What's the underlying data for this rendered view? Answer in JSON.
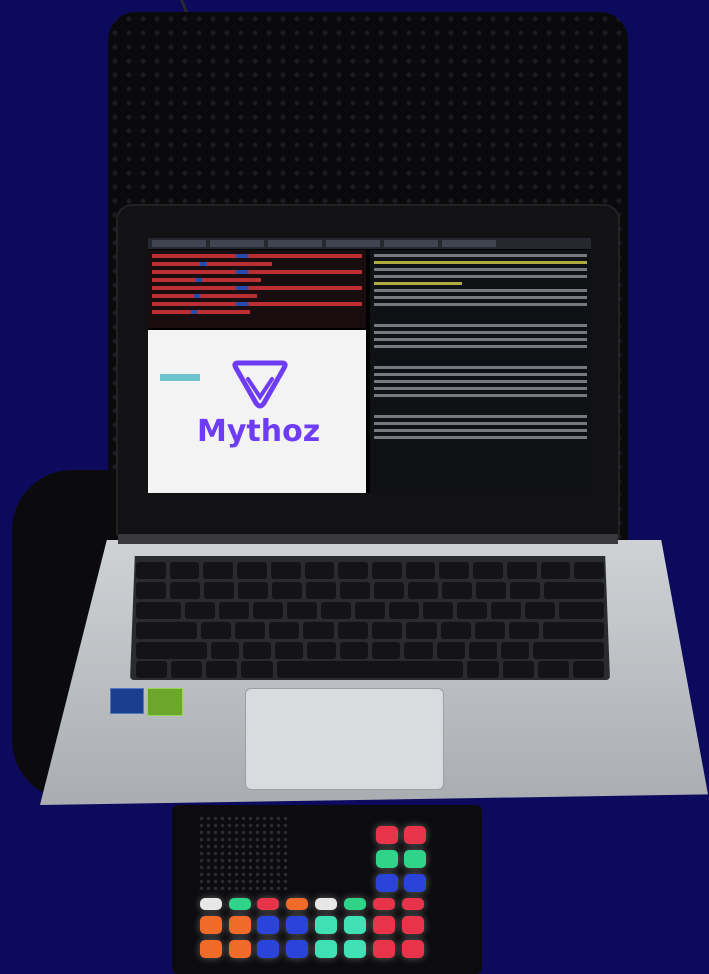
{
  "image": {
    "description_tags": [
      "laptop",
      "hard-case",
      "pad-controller"
    ],
    "background_color": "#0d0a5e"
  },
  "logo": {
    "text": "Mythoz",
    "color": "#6f3cf5",
    "icon": "mythoz-triangle-logo-icon"
  },
  "colors": {
    "pad_red": "#e8344a",
    "pad_green": "#2fd489",
    "pad_blue": "#2a43d8",
    "pad_orange": "#f06a2a",
    "pad_mint": "#3fe0b4"
  }
}
